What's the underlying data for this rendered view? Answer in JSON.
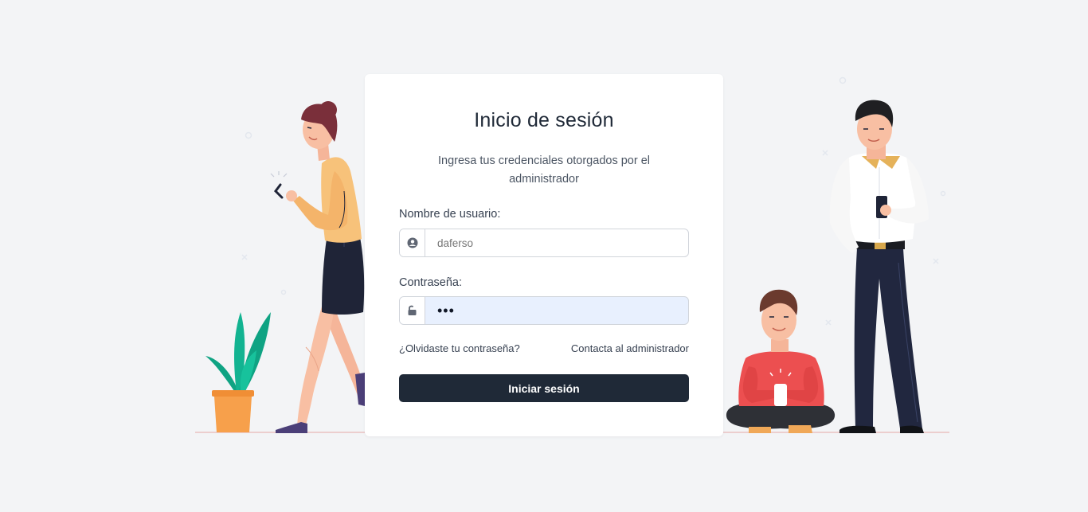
{
  "login": {
    "title": "Inicio de sesión",
    "subtitle": "Ingresa tus credenciales otorgados por el administrador",
    "username": {
      "label": "Nombre de usuario:",
      "placeholder": "daferso",
      "icon": "user-circle-icon"
    },
    "password": {
      "label": "Contraseña:",
      "value": "•••",
      "icon": "unlock-icon"
    },
    "forgot_link": "¿Olvidaste tu contraseña?",
    "contact_link": "Contacta al administrador",
    "submit_label": "Iniciar sesión"
  },
  "colors": {
    "background": "#f3f4f6",
    "button": "#1f2937",
    "autofill": "#e8f0fe",
    "plant": "#10b08d",
    "pot": "#f7a04b"
  }
}
